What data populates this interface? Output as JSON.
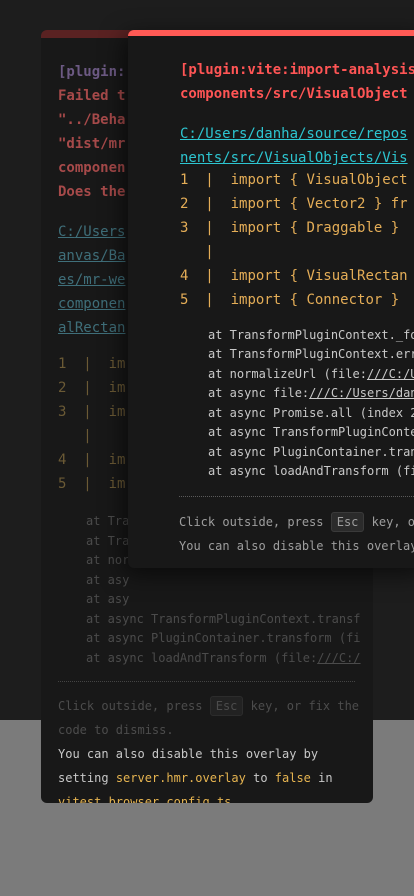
{
  "error_back": {
    "plugin_tag": "[plugin:",
    "message_lines": [
      "Failed t",
      "\"../Beha",
      "\"dist/mr",
      "componen",
      "Does the"
    ],
    "path_prefix": "C:",
    "path_lines": [
      "/Users",
      "anvas/Ba",
      "es/mr-we",
      "componen",
      "alRectan"
    ],
    "code_lines": [
      {
        "num": "1",
        "bar": "|",
        "text": "im"
      },
      {
        "num": "2",
        "bar": "|",
        "text": "im"
      },
      {
        "num": "3",
        "bar": "|",
        "text": "im"
      },
      {
        "num": "",
        "bar": "|",
        "text": ""
      },
      {
        "num": "4",
        "bar": "|",
        "text": "im"
      },
      {
        "num": "5",
        "bar": "|",
        "text": "im"
      }
    ],
    "stack": [
      {
        "text": "at Tra",
        "link": ""
      },
      {
        "text": "at Tra",
        "link": ""
      },
      {
        "text": "at nor",
        "link": ""
      },
      {
        "text": "at asy",
        "link": ""
      },
      {
        "text": "at asy",
        "link": ""
      },
      {
        "text": "at async TransformPluginContext.transf",
        "link": ""
      },
      {
        "text": "at async PluginContainer.transform (fi",
        "link": ""
      },
      {
        "text": "at async loadAndTransform (file:",
        "link": "///C:/"
      }
    ],
    "tip_line1_a": "Click outside, press",
    "esc_key": "Esc",
    "tip_line1_b": "key, or fix the",
    "tip_line2": "code to dismiss.",
    "tip_line3": "You can also disable this overlay by",
    "tip_line4_a": "setting",
    "config_key": "server.hmr.overlay",
    "tip_line4_b": "to",
    "false_word": "false",
    "tip_line4_c": "in",
    "config_file": "vitest.browser.config.ts."
  },
  "error_front": {
    "plugin_tag": "[plugin:vite:import-analysis",
    "message_line": "components/src/VisualObject",
    "path_prefix": "C:",
    "path_line1": "/Users/danha/source/repos",
    "path_line2": "nents/src/VisualObjects/Vis",
    "code_lines": [
      {
        "num": "1",
        "bar": "|",
        "text": "import { VisualObject"
      },
      {
        "num": "2",
        "bar": "|",
        "text": "import { Vector2 } fr"
      },
      {
        "num": "3",
        "bar": "|",
        "text": "import { Draggable }"
      },
      {
        "num": "",
        "bar": "|",
        "text": ""
      },
      {
        "num": "4",
        "bar": "|",
        "text": "import { VisualRectan"
      },
      {
        "num": "5",
        "bar": "|",
        "text": "import { Connector }"
      }
    ],
    "stack": [
      {
        "text": "at TransformPluginContext._fo",
        "link": ""
      },
      {
        "text": "at TransformPluginContext.err",
        "link": ""
      },
      {
        "text": "at normalizeUrl (file:",
        "link": "///C:/U"
      },
      {
        "text": "at async file:",
        "link": "///C:/Users/dan"
      },
      {
        "text": "at async Promise.all (index 2",
        "link": ""
      },
      {
        "text": "at async TransformPluginConte",
        "link": ""
      },
      {
        "text": "at async PluginContainer.tran",
        "link": ""
      },
      {
        "text": "at async loadAndTransform (fi",
        "link": ""
      }
    ],
    "tip_line1_a": "Click outside, press",
    "esc_key": "Esc",
    "tip_line1_b": "key, or",
    "tip_line2": "You can also disable this overlay"
  }
}
